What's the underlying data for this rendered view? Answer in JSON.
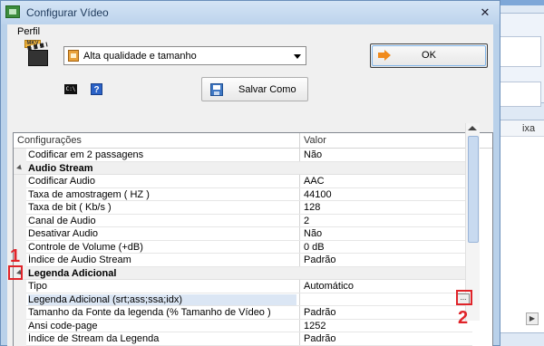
{
  "window": {
    "title": "Configurar Vídeo",
    "close_glyph": "✕"
  },
  "profile": {
    "label": "Perfil",
    "selected": "Alta qualidade e tamanho"
  },
  "buttons": {
    "ok": "OK",
    "save_as": "Salvar Como",
    "help": "?",
    "ellipsis": "...",
    "cmd": "C:\\"
  },
  "grid": {
    "header_config": "Configurações",
    "header_value": "Valor",
    "rows": [
      {
        "type": "prop",
        "name": "Codificar em 2 passagens",
        "value": "Não"
      },
      {
        "type": "cat",
        "name": "Audio Stream"
      },
      {
        "type": "prop",
        "name": "Codificar Audio",
        "value": "AAC"
      },
      {
        "type": "prop",
        "name": "Taxa de amostragem ( HZ )",
        "value": "44100"
      },
      {
        "type": "prop",
        "name": "Taxa de bit ( Kb/s )",
        "value": "128"
      },
      {
        "type": "prop",
        "name": "Canal de Audio",
        "value": "2"
      },
      {
        "type": "prop",
        "name": "Desativar Audio",
        "value": "Não"
      },
      {
        "type": "prop",
        "name": "Controle de Volume (+dB)",
        "value": "0 dB"
      },
      {
        "type": "prop",
        "name": "Índice de Audio Stream",
        "value": "Padrão"
      },
      {
        "type": "cat",
        "name": "Legenda Adicional"
      },
      {
        "type": "prop",
        "name": "Tipo",
        "value": "Automático"
      },
      {
        "type": "prop",
        "name": "Legenda Adicional (srt;ass;ssa;idx)",
        "value": "",
        "selected": true
      },
      {
        "type": "prop",
        "name": "Tamanho da Fonte da legenda (% Tamanho de Vídeo )",
        "value": "Padrão"
      },
      {
        "type": "prop",
        "name": "Ansi code-page",
        "value": "1252"
      },
      {
        "type": "prop",
        "name": "Índice de Stream da Legenda",
        "value": "Padrão"
      }
    ]
  },
  "annotations": {
    "one": "1",
    "two": "2"
  },
  "background_app": {
    "column_fragment": "ixa",
    "scroll_glyph": "▶"
  },
  "colors": {
    "annotation": "#e0242a",
    "titlebar": "#bcd3ec"
  }
}
